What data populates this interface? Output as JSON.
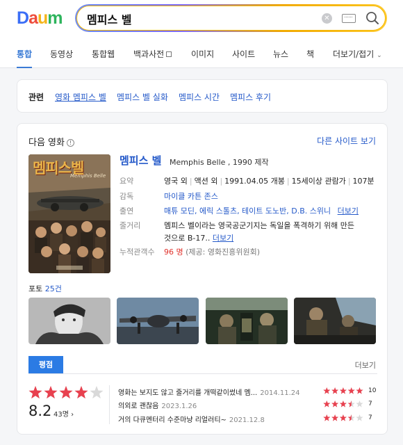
{
  "logo": {
    "letters": [
      "D",
      "a",
      "u",
      "m"
    ],
    "colors": [
      "#3b6ef6",
      "#ee4c3b",
      "#f4b41a",
      "#2db45c"
    ]
  },
  "search": {
    "value": "멤피스 벨",
    "clear_icon": "close-circle-icon",
    "keyboard_icon": "keyboard-icon",
    "search_icon": "magnifier-icon"
  },
  "nav": {
    "items": [
      "통합",
      "동영상",
      "통합웹",
      "백과사전",
      "이미지",
      "사이트",
      "뉴스",
      "책",
      "더보기/접기"
    ],
    "active_index": 0
  },
  "related": {
    "title": "관련",
    "links": [
      "영화 멤피스 벨",
      "멤피스 벨 실화",
      "멤피스 시간",
      "멤피스 후기"
    ]
  },
  "movie": {
    "section_title": "다음 영화",
    "other_sites": "다른 사이트 보기",
    "poster_title": "멤피스벨",
    "poster_sub": "Memphis Belle",
    "name": "멤피스 벨",
    "original_title": "Memphis Belle , 1990 제작",
    "rows": {
      "summary_label": "요약",
      "summary_parts": [
        "영국 외",
        "액션 외",
        "1991.04.05 개봉",
        "15세이상 관람가",
        "107분"
      ],
      "director_label": "감독",
      "director": "마이클 카튼 존스",
      "cast_label": "출연",
      "cast": "매튜 모딘, 에릭 스톨츠, 테이트 도노반, D.B. 스위니",
      "cast_more": "더보기",
      "plot_label": "줄거리",
      "plot_line1": "멤피스 벨이라는 영국공군기지는 독일을 폭격하기 위해 만든",
      "plot_line2": "것으로 B-17..",
      "plot_more": "더보기",
      "audience_label": "누적관객수",
      "audience_value": "96 명",
      "audience_source": "(제공: 영화진흥위원회)"
    },
    "photo_label": "포토",
    "photo_count": "25건"
  },
  "rating": {
    "tab": "평점",
    "more": "더보기",
    "score": "8.2",
    "count": "43명 ›",
    "stars_out_of_5": 4,
    "reviews": [
      {
        "text": "영화는 보지도 않고 줄거리를 개떡같이썼네 멤...",
        "date": "2014.11.24",
        "score": "10",
        "stars": 5
      },
      {
        "text": "의외로 괜찮음",
        "date": "2023.1.26",
        "score": "7",
        "stars": 3.5
      },
      {
        "text": "거의 다큐멘터리 수준마냥 리얼러티~",
        "date": "2021.12.8",
        "score": "7",
        "stars": 3.5
      }
    ],
    "star_color": "#e8414f"
  }
}
